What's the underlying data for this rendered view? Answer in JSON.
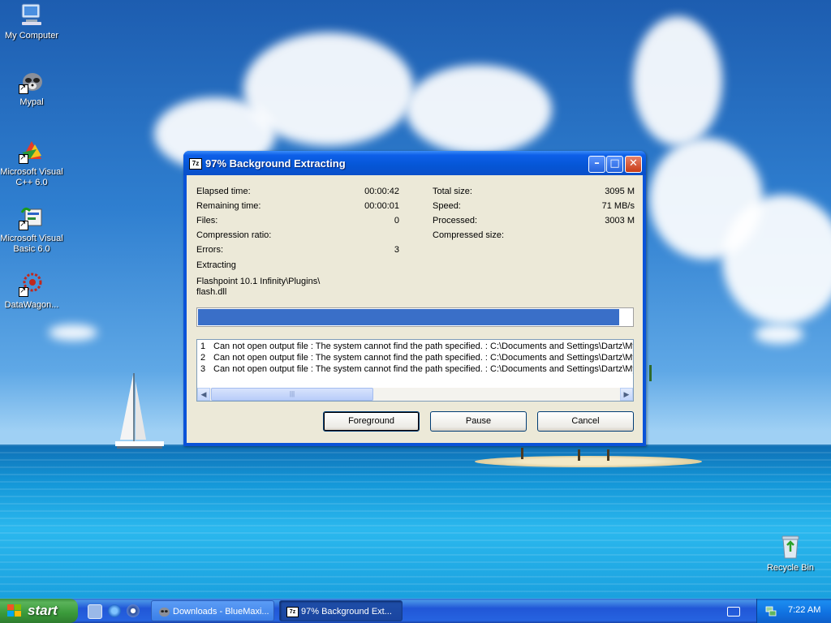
{
  "desktop": {
    "icons": [
      {
        "label": "My Computer"
      },
      {
        "label": "Mypal"
      },
      {
        "label": "Microsoft Visual C++ 6.0"
      },
      {
        "label": "Microsoft Visual Basic 6.0"
      },
      {
        "label": "DataWagon..."
      },
      {
        "label": "Recycle Bin"
      }
    ]
  },
  "window": {
    "icon_text": "7z",
    "title": "97% Background Extracting",
    "left_fields": [
      {
        "label": "Elapsed time:",
        "value": "00:00:42"
      },
      {
        "label": "Remaining time:",
        "value": "00:00:01"
      },
      {
        "label": "Files:",
        "value": "0"
      },
      {
        "label": "Compression ratio:",
        "value": ""
      },
      {
        "label": "Errors:",
        "value": "3"
      }
    ],
    "right_fields": [
      {
        "label": "Total size:",
        "value": "3095 M"
      },
      {
        "label": "Speed:",
        "value": "71 MB/s"
      },
      {
        "label": "Processed:",
        "value": "3003 M"
      },
      {
        "label": "Compressed size:",
        "value": ""
      }
    ],
    "status_label": "Extracting",
    "current_file_line1": "Flashpoint 10.1 Infinity\\Plugins\\",
    "current_file_line2": "flash.dll",
    "progress_fraction": 0.97,
    "log_rows": [
      {
        "num": "1",
        "text": "Can not open output file : The system cannot find the path specified. : C:\\Documents and Settings\\Dartz\\My I"
      },
      {
        "num": "2",
        "text": "Can not open output file : The system cannot find the path specified. : C:\\Documents and Settings\\Dartz\\My I"
      },
      {
        "num": "3",
        "text": "Can not open output file : The system cannot find the path specified. : C:\\Documents and Settings\\Dartz\\My I"
      }
    ],
    "buttons": {
      "foreground": "Foreground",
      "pause": "Pause",
      "cancel": "Cancel"
    }
  },
  "taskbar": {
    "start_label": "start",
    "tasks": [
      {
        "label": "Downloads - BlueMaxi...",
        "active": false
      },
      {
        "label": "97% Background Ext...",
        "active": true
      }
    ],
    "clock": "7:22 AM"
  },
  "colors": {
    "titlebar_blue": "#0556d6",
    "progress_fill": "#3a6fc8",
    "dialog_bg": "#ece9d8",
    "start_green": "#3a9a3a"
  }
}
